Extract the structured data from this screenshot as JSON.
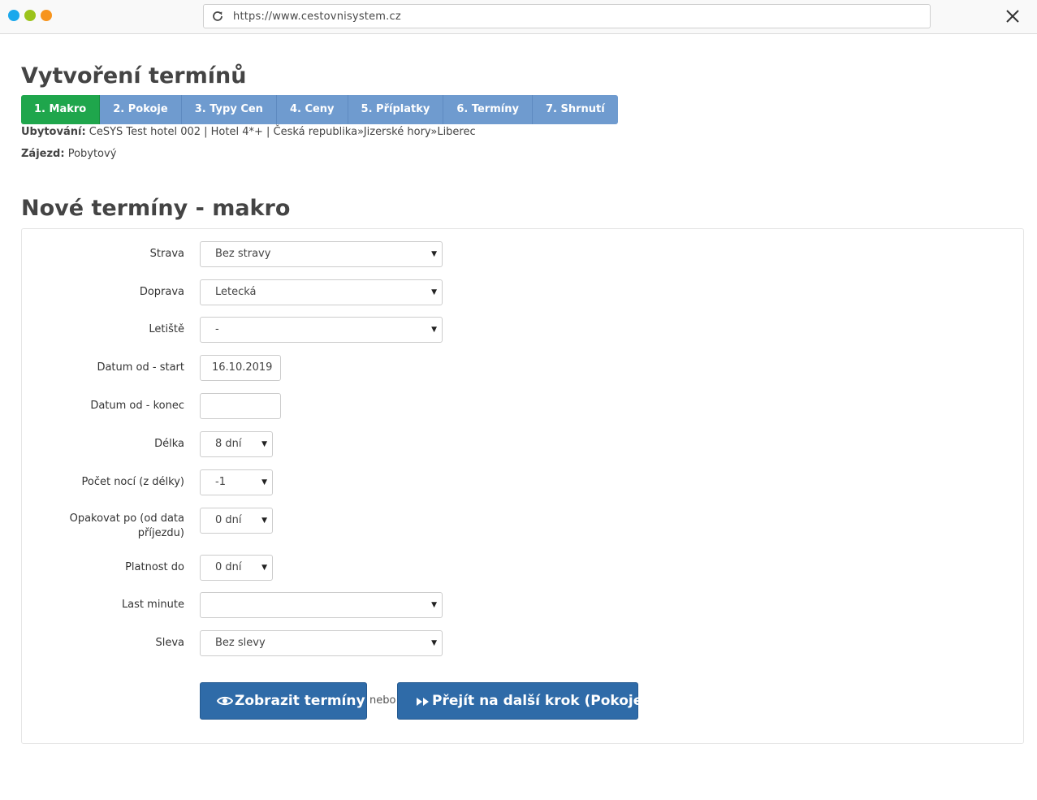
{
  "browser": {
    "url": "https://www.cestovnisystem.cz"
  },
  "page": {
    "title": "Vytvoření termínů",
    "wizard_steps": [
      {
        "label": "1. Makro",
        "active": true
      },
      {
        "label": "2. Pokoje",
        "active": false
      },
      {
        "label": "3. Typy Cen",
        "active": false
      },
      {
        "label": "4. Ceny",
        "active": false
      },
      {
        "label": "5. Příplatky",
        "active": false
      },
      {
        "label": "6. Termíny",
        "active": false
      },
      {
        "label": "7. Shrnutí",
        "active": false
      }
    ],
    "accommodation_label": "Ubytování:",
    "accommodation_value": "CeSYS Test hotel 002 | Hotel 4*+ | Česká republika»Jizerské hory»Liberec",
    "trip_label": "Zájezd:",
    "trip_value": "Pobytový"
  },
  "form": {
    "section_title": "Nové termíny - makro",
    "fields": {
      "strava": {
        "label": "Strava",
        "value": "Bez stravy"
      },
      "doprava": {
        "label": "Doprava",
        "value": "Letecká"
      },
      "letiste": {
        "label": "Letiště",
        "value": "-"
      },
      "datum_start": {
        "label": "Datum od - start",
        "value": "16.10.2019"
      },
      "datum_konec": {
        "label": "Datum od - konec",
        "value": ""
      },
      "delka": {
        "label": "Délka",
        "value": "8 dní"
      },
      "pocet_noci": {
        "label": "Počet nocí (z délky)",
        "value": "-1"
      },
      "opakovat": {
        "label_line1": "Opakovat po (od data",
        "label_line2": "příjezdu)",
        "value": "0 dní"
      },
      "platnost": {
        "label": "Platnost do",
        "value": "0 dní"
      },
      "last_minute": {
        "label": "Last minute",
        "value": ""
      },
      "sleva": {
        "label": "Sleva",
        "value": "Bez slevy"
      }
    },
    "buttons": {
      "show_label": "Zobrazit termíny",
      "or_text": "nebo",
      "next_label": "Přejít na další krok (Pokoje)"
    }
  },
  "colors": {
    "active_step": "#1fa64c",
    "inactive_step": "#6f9bcf",
    "primary_button": "#2f6ba8"
  },
  "icons": {
    "reload": "reload-icon",
    "close": "close-icon",
    "eye": "eye-icon",
    "forward": "fast-forward-icon",
    "caret": "caret-down-icon"
  }
}
